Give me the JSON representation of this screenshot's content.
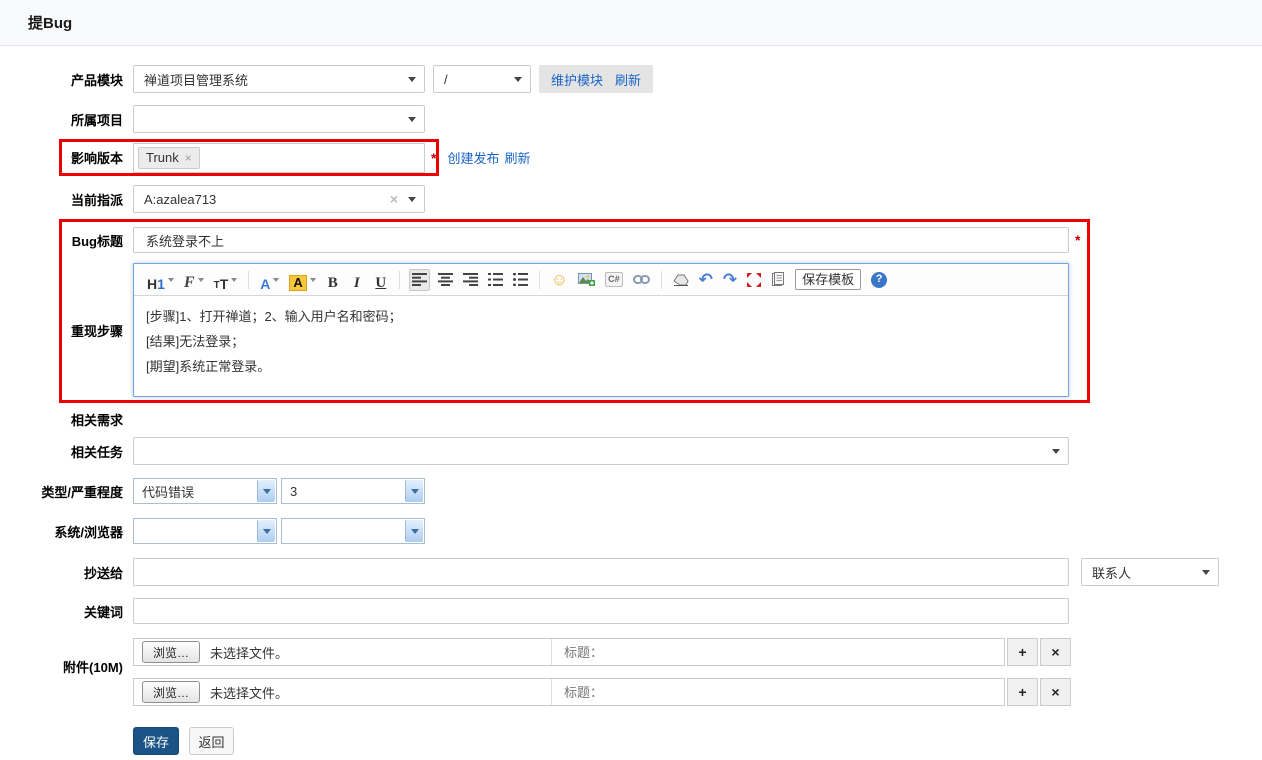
{
  "colors": {
    "annotation_red": "#ee0000",
    "required_red": "#cc0000",
    "link_blue": "#1a64c8",
    "save_button_blue": "#1a5386",
    "editor_border_blue": "#74a7df"
  },
  "header": {
    "title": "提Bug"
  },
  "form": {
    "product_module": {
      "label": "产品模块",
      "product_select_value": "禅道项目管理系统",
      "module_select_value": "/",
      "maintain_module_link": "维护模块",
      "refresh_link": "刷新"
    },
    "project": {
      "label": "所属项目",
      "select_value": ""
    },
    "affected_version": {
      "label": "影响版本",
      "tag_value": "Trunk",
      "tag_remove_icon": "×",
      "required_mark": "*",
      "create_release_link": "创建发布",
      "refresh_link": "刷新"
    },
    "assigned_to": {
      "label": "当前指派",
      "select_value": "A:azalea713",
      "clear_icon": "×"
    },
    "bug_title": {
      "label": "Bug标题",
      "value": "系统登录不上",
      "required_mark": "*"
    },
    "steps": {
      "label": "重现步骤",
      "content_lines": [
        "[步骤]1、打开禅道；2、输入用户名和密码；",
        "[结果]无法登录；",
        "[期望]系统正常登录。"
      ]
    },
    "related_story": {
      "label": "相关需求"
    },
    "related_task": {
      "label": "相关任务",
      "select_value": ""
    },
    "type_severity": {
      "label": "类型/严重程度",
      "type_value": "代码错误",
      "severity_value": "3"
    },
    "os_browser": {
      "label": "系统/浏览器",
      "os_value": "",
      "browser_value": ""
    },
    "cc": {
      "label": "抄送给",
      "value": "",
      "contacts_select_value": "联系人"
    },
    "keywords": {
      "label": "关键词",
      "value": ""
    },
    "attachments": {
      "label": "附件(10M)",
      "rows": [
        {
          "browse_button": "浏览…",
          "file_status": "未选择文件。",
          "title_placeholder": "标题：",
          "add_button": "+",
          "remove_button": "×"
        },
        {
          "browse_button": "浏览…",
          "file_status": "未选择文件。",
          "title_placeholder": "标题：",
          "add_button": "+",
          "remove_button": "×"
        }
      ]
    },
    "actions": {
      "save_button": "保存",
      "back_button": "返回"
    }
  },
  "editor": {
    "toolbar": {
      "heading_h": "H",
      "heading_num": "1",
      "font_family": "F",
      "font_size_small": "T",
      "font_size_large": "T",
      "text_color": "A",
      "highlight_color": "A",
      "bold": "B",
      "italic": "I",
      "underline": "U",
      "code_label": "C#",
      "save_template_button": "保存模板",
      "help_mark": "?"
    },
    "icon_buttons": [
      "heading-dropdown",
      "font-family-dropdown",
      "font-size-dropdown",
      "text-color-dropdown",
      "highlight-color-dropdown",
      "bold",
      "italic",
      "underline",
      "align-left",
      "align-center",
      "align-right",
      "ordered-list",
      "unordered-list",
      "emoji",
      "insert-image",
      "insert-code",
      "insert-link",
      "remove-format",
      "undo",
      "redo",
      "fullscreen",
      "paste-template",
      "save-template",
      "help"
    ]
  }
}
